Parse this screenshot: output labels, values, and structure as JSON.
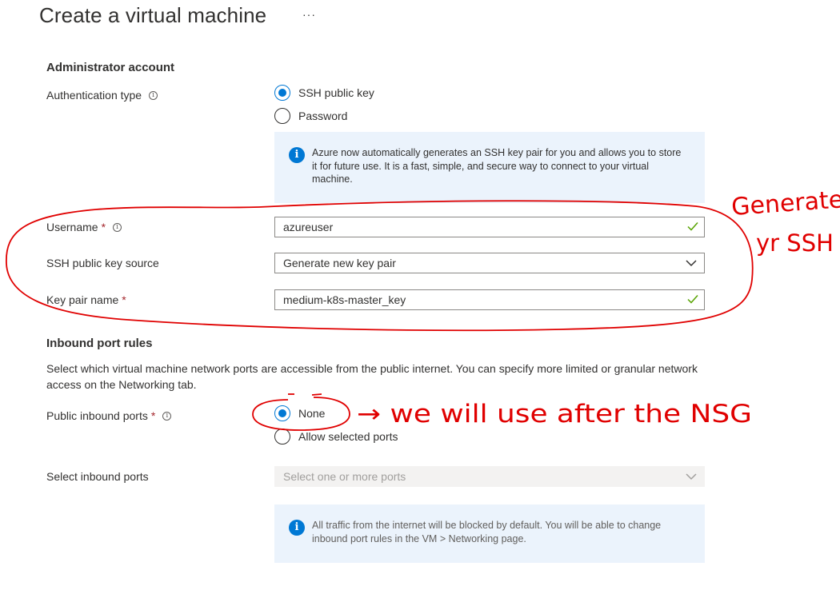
{
  "header": {
    "title": "Create a virtual machine",
    "more": "···"
  },
  "admin": {
    "section_title": "Administrator account",
    "auth_type_label": "Authentication type",
    "auth_options": [
      {
        "label": "SSH public key",
        "checked": true
      },
      {
        "label": "Password",
        "checked": false
      }
    ],
    "info_text": "Azure now automatically generates an SSH key pair for you and allows you to store it for future use. It is a fast, simple, and secure way to connect to your virtual machine.",
    "username_label": "Username",
    "username_value": "azureuser",
    "ssh_source_label": "SSH public key source",
    "ssh_source_value": "Generate new key pair",
    "key_pair_label": "Key pair name",
    "key_pair_value": "medium-k8s-master_key",
    "required_mark": "*"
  },
  "inbound": {
    "section_title": "Inbound port rules",
    "description": "Select which virtual machine network ports are accessible from the public internet. You can specify more limited or granular network access on the Networking tab.",
    "public_ports_label": "Public inbound ports",
    "port_options": [
      {
        "label": "None",
        "checked": true
      },
      {
        "label": "Allow selected ports",
        "checked": false
      }
    ],
    "select_ports_label": "Select inbound ports",
    "select_ports_placeholder": "Select one or more ports",
    "info_text": "All traffic from the internet will be blocked by default. You will be able to change inbound port rules in the VM > Networking page."
  },
  "annotations": {
    "note_1_line1": "Generate",
    "note_1_line2": "yr SSH",
    "note_2": "→ we will use after the NSG",
    "ink_color": "#e00000"
  },
  "colors": {
    "accent": "#0078d4",
    "required": "#a4262c",
    "valid": "#57a300",
    "info_bg": "#ebf3fc"
  }
}
